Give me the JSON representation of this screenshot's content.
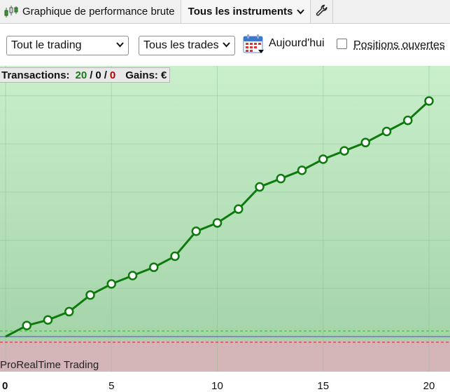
{
  "tabs": [
    {
      "label": "Graphique de performance brute",
      "icon": "candlestick-icon"
    },
    {
      "label": "Tous les instruments",
      "icon": "chevron-down-icon"
    },
    {
      "label": "",
      "icon": "wrench-icon"
    }
  ],
  "toolbar": {
    "scope_select": "Tout le trading",
    "trades_select": "Tous les trades",
    "date_label": "Aujourd'hui",
    "open_positions_label": "Positions ouvertes",
    "open_positions_checked": false
  },
  "summary": {
    "label": "Transactions:",
    "total": "20",
    "sep1": "/",
    "neutral": "0",
    "sep2": "/",
    "losing": "0",
    "gains_label": "Gains:",
    "gains_value": "€"
  },
  "brand": "ProRealTime Trading",
  "colors": {
    "line": "#0e7a0e",
    "positive_bg_top": "#c9efcb",
    "positive_bg_bottom": "#a5d4a9",
    "negative_bg": "#d4b6b8",
    "zero_line": "#5050c0",
    "upper_dashed": "#33cc33",
    "lower_dashed": "#ee3333"
  },
  "chart_data": {
    "type": "line",
    "x_ticks": [
      "0",
      "5",
      "10",
      "15",
      "20"
    ],
    "x": [
      0,
      1,
      2,
      3,
      4,
      5,
      6,
      7,
      8,
      9,
      10,
      11,
      12,
      13,
      14,
      15,
      16,
      17,
      18,
      19,
      20
    ],
    "values": [
      0,
      0.4,
      0.6,
      0.9,
      1.5,
      1.9,
      2.2,
      2.5,
      2.9,
      3.8,
      4.1,
      4.6,
      5.4,
      5.7,
      6.0,
      6.4,
      6.7,
      7.0,
      7.4,
      7.8,
      8.5
    ],
    "markers_from_index": 1,
    "xlim": [
      0,
      20
    ],
    "ylim": [
      -1.3,
      9.5
    ],
    "grid": true
  }
}
